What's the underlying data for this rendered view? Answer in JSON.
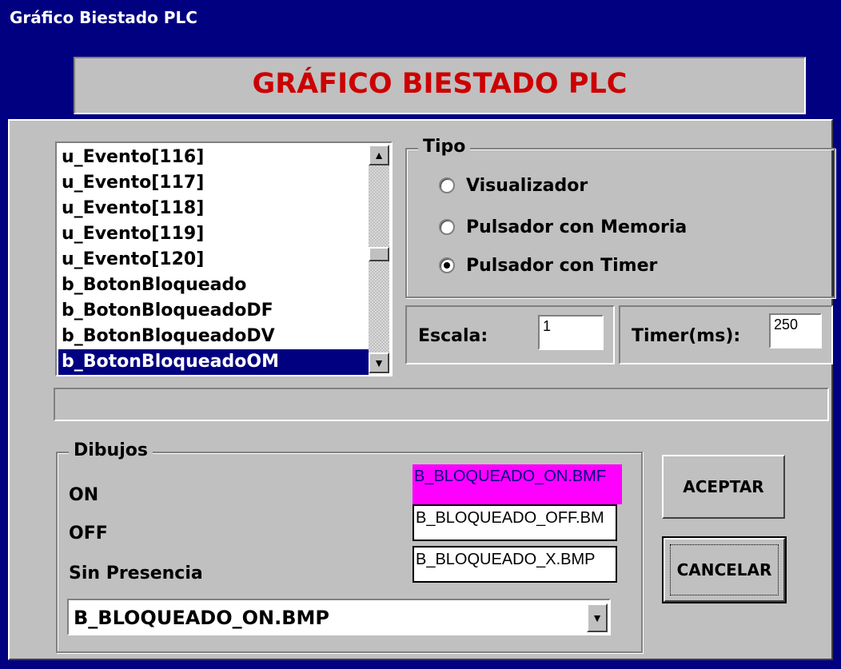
{
  "window": {
    "title": "Gráfico Biestado PLC"
  },
  "banner": {
    "text": "GRÁFICO BIESTADO PLC"
  },
  "variable_list": {
    "items": [
      "u_Evento[116]",
      "u_Evento[117]",
      "u_Evento[118]",
      "u_Evento[119]",
      "u_Evento[120]",
      "b_BotonBloqueado",
      "b_BotonBloqueadoDF",
      "b_BotonBloqueadoDV",
      "b_BotonBloqueadoOM"
    ],
    "selected": "b_BotonBloqueadoOM"
  },
  "tipo": {
    "label": "Tipo",
    "options": [
      {
        "label": "Visualizador",
        "selected": false
      },
      {
        "label": "Pulsador con Memoria",
        "selected": false
      },
      {
        "label": "Pulsador con Timer",
        "selected": true
      }
    ]
  },
  "escala": {
    "label": "Escala:",
    "value": "1"
  },
  "timer": {
    "label": "Timer(ms):",
    "value": "250"
  },
  "dibujos": {
    "label": "Dibujos",
    "on_label": "ON",
    "off_label": "OFF",
    "sin_label": "Sin Presencia",
    "on_file": "B_BLOQUEADO_ON.BMF",
    "off_file": "B_BLOQUEADO_OFF.BM",
    "sin_file": "B_BLOQUEADO_X.BMP",
    "selected_file": "B_BLOQUEADO_ON.BMP"
  },
  "buttons": {
    "accept": "ACEPTAR",
    "cancel": "CANCELAR"
  },
  "colors": {
    "titlebar": "#000080",
    "banner_text": "#cc0000",
    "highlight": "#ff00ff",
    "face": "#c0c0c0"
  }
}
